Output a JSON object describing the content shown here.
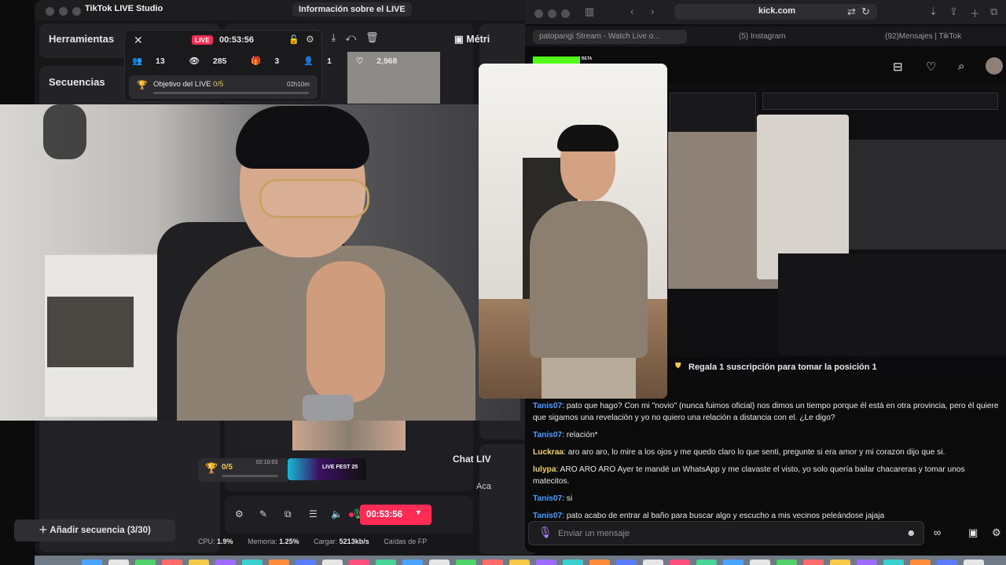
{
  "studio": {
    "title": "TikTok LIVE Studio",
    "live_info_button": "Información sobre el LIVE",
    "tools_title": "Herramientas",
    "sequences_title": "Secuencias",
    "add_sequence": "Añadir secuencia (3/30)",
    "metrics_title": "Métri",
    "chat_live_title": "Chat LIV",
    "chat_live_sub": "Aca",
    "timer": "00:53:56",
    "goal_small_value": "0/5",
    "goal_small_time": "02:10:03",
    "livefest": "LIVE FEST 25",
    "stats": {
      "cpu_label": "CPU:",
      "cpu": "1.9%",
      "mem_label": "Memoria:",
      "mem": "1.25%",
      "load_label": "Cargar:",
      "load": "5213kb/s",
      "fps_label": "Caídas de FP"
    }
  },
  "live_card": {
    "badge": "LIVE",
    "time": "00:53:56",
    "viewers_total": "13",
    "views": "285",
    "gifts": "3",
    "followers": "1",
    "likes": "2,968",
    "goal_label": "Objetivo del LIVE",
    "goal_progress": "0/5",
    "goal_time": "02h10m"
  },
  "kick": {
    "url": "kick.com",
    "tabs": [
      "patopangi Stream - Watch Live o...",
      "(5) Instagram",
      "(92)Mensajes | TikTok"
    ],
    "beta": "BETA",
    "pinned": "Regala 1 suscripción para tomar la posición 1",
    "chat_placeholder": "Enviar un mensaje",
    "messages": [
      {
        "user": "Tanis07",
        "color": "#4a9dff",
        "text": ": pato que hago? Con mi \"novio\" (nunca fuimos oficial) nos dimos un tiempo porque él está en otra provincia, pero él quiere que sigamos una revelación y yo no quiero una relación a distancia con el. ¿Le digo?"
      },
      {
        "user": "Tanis07",
        "color": "#4a9dff",
        "text": ": relación*"
      },
      {
        "user": "Luckraa",
        "color": "#f3d35b",
        "text": ": aro aro aro, lo mire a los ojos y me quedo claro lo que senti, pregunte si era amor y mi corazon dijo que si."
      },
      {
        "user": "lulypa",
        "color": "#f3d35b",
        "text": ": ARO ARO ARO Ayer te mandé un WhatsApp y me clavaste el visto, yo solo quería bailar chacareras y tomar unos matecitos."
      },
      {
        "user": "Tanis07",
        "color": "#4a9dff",
        "text": ": si"
      },
      {
        "user": "Tanis07",
        "color": "#4a9dff",
        "text": ": pato acabo de entrar al baño para buscar algo y escucho a mis vecinos peleándose jajaja"
      }
    ]
  },
  "colors": {
    "accent": "#fe2c55",
    "kick_green": "#53fc18",
    "gold": "#f1c94a"
  }
}
